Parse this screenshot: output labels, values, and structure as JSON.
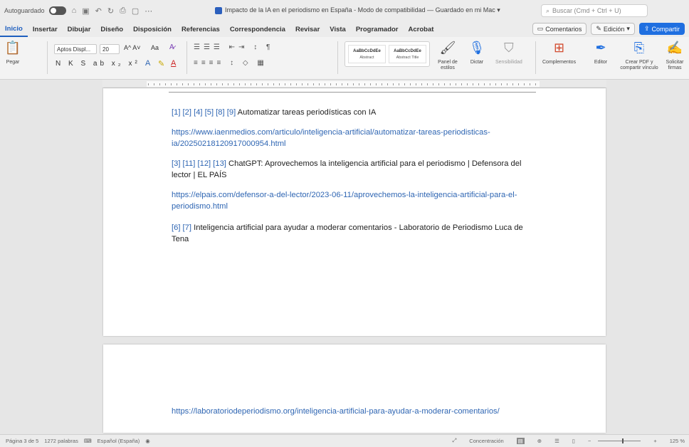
{
  "titlebar": {
    "autosave_label": "Autoguardado",
    "document_title": "Impacto de la IA en el periodismo en España  -  Modo de compatibilidad — Guardado en mi Mac ▾",
    "search_placeholder": "Buscar (Cmd + Ctrl + U)"
  },
  "menu": {
    "tabs": [
      "Inicio",
      "Insertar",
      "Dibujar",
      "Diseño",
      "Disposición",
      "Referencias",
      "Correspondencia",
      "Revisar",
      "Vista",
      "Programador",
      "Acrobat"
    ],
    "comments": "Comentarios",
    "editing": "Edición",
    "share": "Compartir"
  },
  "ribbon": {
    "paste": "Pegar",
    "font_name": "Aptos Displ...",
    "font_size": "20",
    "grow_shrink": "A^  A˅",
    "case": "Aa",
    "format_row": "N  K  S  ab  x₂  x²",
    "styles": [
      {
        "sample": "AaBbCcDdEe",
        "name": "Abstract"
      },
      {
        "sample": "AaBbCcDdEe",
        "name": "Abstract Title"
      }
    ],
    "styles_panel": "Panel de estilos",
    "dictate": "Dictar",
    "sensitivity": "Sensibilidad",
    "addins": "Complementos",
    "editor": "Editor",
    "create_pdf": "Crear PDF y compartir vínculo",
    "request_signatures": "Solicitar firmas"
  },
  "document": {
    "p1_refs": "[1] [2] [4] [5] [8] [9]",
    "p1_text": " Automatizar tareas periodísticas con IA",
    "p2": "https://www.iaenmedios.com/articulo/inteligencia-artificial/automatizar-tareas-periodisticas-ia/20250218120917000954.html",
    "p3_refs": "[3] [11] [12] [13]",
    "p3_text": " ChatGPT: Aprovechemos la inteligencia artificial para el periodismo | Defensora del lector | EL PAÍS",
    "p4": "https://elpais.com/defensor-a-del-lector/2023-06-11/aprovechemos-la-inteligencia-artificial-para-el-periodismo.html",
    "p5_refs": "[6] [7]",
    "p5_text": " Inteligencia artificial para ayudar a moderar comentarios - Laboratorio de Periodismo Luca de Tena",
    "p6": "https://laboratoriodeperiodismo.org/inteligencia-artificial-para-ayudar-a-moderar-comentarios/"
  },
  "status": {
    "page": "Página 3 de 5",
    "words": "1272 palabras",
    "language": "Español (España)",
    "focus": "Concentración",
    "zoom": "125 %"
  }
}
